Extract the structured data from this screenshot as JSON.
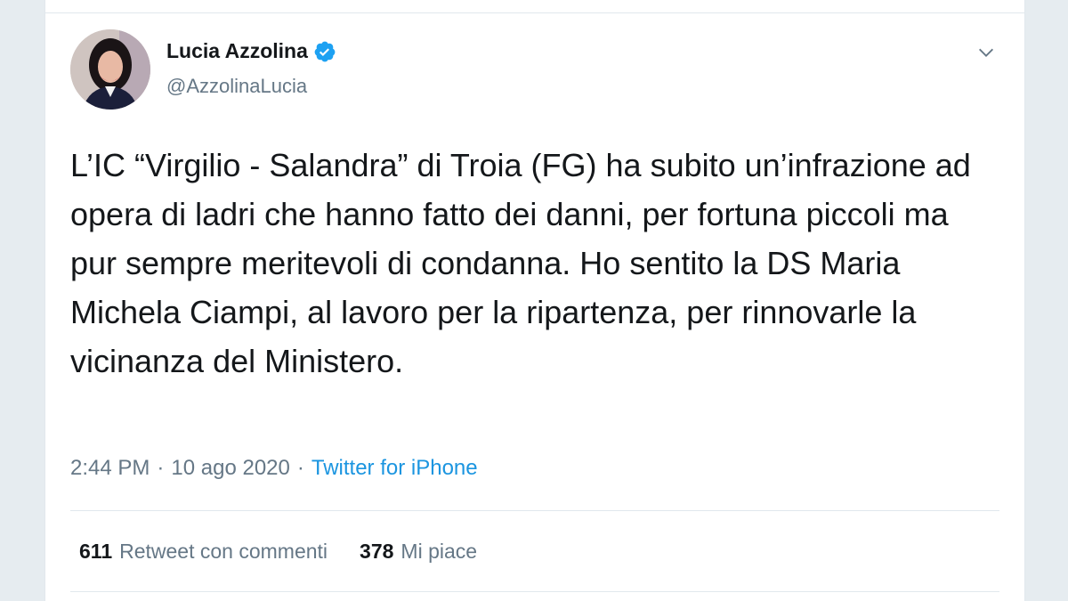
{
  "author": {
    "display_name": "Lucia Azzolina",
    "handle": "@AzzolinaLucia",
    "verified": true,
    "avatar_icon": "profile-photo"
  },
  "tweet": {
    "text": "L’IC “Virgilio - Salandra” di Troia (FG) ha subito un’infrazione ad opera di ladri che hanno fatto dei danni, per fortuna piccoli ma pur sempre meritevoli di condanna. Ho sentito la DS Maria Michela Ciampi, al lavoro per la ripartenza, per rinnovarle la vicinanza del Ministero.",
    "time": "2:44 PM",
    "separator": "·",
    "date": "10 ago 2020",
    "source_separator": "·",
    "source": "Twitter for iPhone"
  },
  "stats": {
    "retweets_count": "611",
    "retweets_label": "Retweet con commenti",
    "likes_count": "378",
    "likes_label": "Mi piace"
  },
  "colors": {
    "accent": "#1b95e0",
    "verified": "#1da1f2",
    "text": "#14171a",
    "secondary": "#657786"
  }
}
